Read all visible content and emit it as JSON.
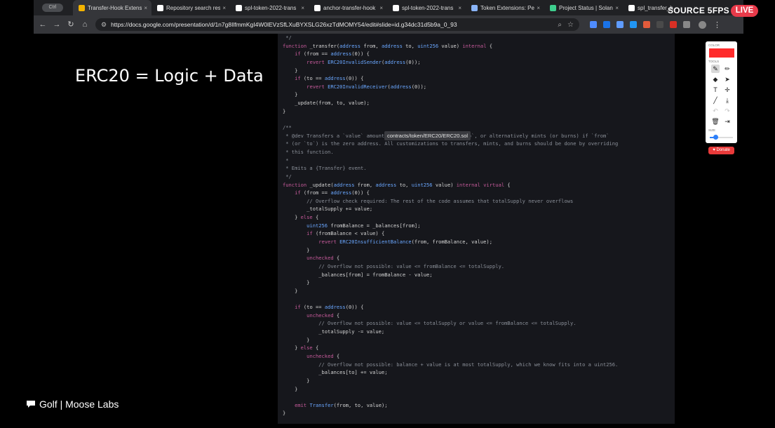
{
  "browser": {
    "tab_pill": "Ctrl",
    "tabs": [
      {
        "label": "Transfer-Hook Extens",
        "favicon_color": "#f4b400",
        "active": true
      },
      {
        "label": "Repository search res",
        "favicon_color": "#ffffff",
        "active": false
      },
      {
        "label": "spl-token-2022-trans",
        "favicon_color": "#ffffff",
        "active": false
      },
      {
        "label": "anchor-transfer-hook",
        "favicon_color": "#ffffff",
        "active": false
      },
      {
        "label": "spl-token-2022-trans",
        "favicon_color": "#ffffff",
        "active": false
      },
      {
        "label": "Token Extensions: Per",
        "favicon_color": "#8ab4f8",
        "active": false
      },
      {
        "label": "Project Status | Solan",
        "favicon_color": "#3ecf8e",
        "active": false
      },
      {
        "label": "spl_transfer_h",
        "favicon_color": "#ffffff",
        "active": false
      }
    ],
    "url": "https://docs.google.com/presentation/d/1n7g8IlfmmKgI4W0lEVzSfLXuBYXSLG26xzTdMOMY54/edit#slide=id.g34dc31d5b9a_0_93",
    "extension_colors": [
      "#4f8cff",
      "#1a73e8",
      "#5f9cff",
      "#2196f3",
      "#e25b3b",
      "#4a4a4a",
      "#d93025",
      "#888888"
    ]
  },
  "stream": {
    "source_badge": "SOURCE 5FPS",
    "live_badge": "LIVE"
  },
  "slide": {
    "title": "ERC20 = Logic + Data"
  },
  "tooltip": "contracts/token/ERC20/ERC20.sol",
  "code_lines": [
    {
      "t": " */",
      "c": "cm"
    },
    {
      "t": "function _transfer(address from, address to, uint256 value) internal {",
      "c": "kw"
    },
    {
      "t": "    if (from == address(0)) {",
      "c": "kw"
    },
    {
      "t": "        revert ERC20InvalidSender(address(0));",
      "c": "err"
    },
    {
      "t": "    }",
      "c": "pl"
    },
    {
      "t": "    if (to == address(0)) {",
      "c": "kw"
    },
    {
      "t": "        revert ERC20InvalidReceiver(address(0));",
      "c": "err"
    },
    {
      "t": "    }",
      "c": "pl"
    },
    {
      "t": "    _update(from, to, value);",
      "c": "pl"
    },
    {
      "t": "}",
      "c": "pl"
    },
    {
      "t": "",
      "c": "pl"
    },
    {
      "t": "/**",
      "c": "cm"
    },
    {
      "t": " * @dev Transfers a `value` amount of tokens from `from` to `to`, or alternatively mints (or burns) if `from`",
      "c": "cm"
    },
    {
      "t": " * (or `to`) is the zero address. All customizations to transfers, mints, and burns should be done by overriding",
      "c": "cm"
    },
    {
      "t": " * this function.",
      "c": "cm"
    },
    {
      "t": " *",
      "c": "cm"
    },
    {
      "t": " * Emits a {Transfer} event.",
      "c": "cm"
    },
    {
      "t": " */",
      "c": "cm"
    },
    {
      "t": "function _update(address from, address to, uint256 value) internal virtual {",
      "c": "kw"
    },
    {
      "t": "    if (from == address(0)) {",
      "c": "kw"
    },
    {
      "t": "        // Overflow check required: The rest of the code assumes that totalSupply never overflows",
      "c": "cm"
    },
    {
      "t": "        _totalSupply += value;",
      "c": "pl"
    },
    {
      "t": "    } else {",
      "c": "kw"
    },
    {
      "t": "        uint256 fromBalance = _balances[from];",
      "c": "kw"
    },
    {
      "t": "        if (fromBalance < value) {",
      "c": "kw"
    },
    {
      "t": "            revert ERC20InsufficientBalance(from, fromBalance, value);",
      "c": "err"
    },
    {
      "t": "        }",
      "c": "pl"
    },
    {
      "t": "        unchecked {",
      "c": "kw"
    },
    {
      "t": "            // Overflow not possible: value <= fromBalance <= totalSupply.",
      "c": "cm"
    },
    {
      "t": "            _balances[from] = fromBalance - value;",
      "c": "pl"
    },
    {
      "t": "        }",
      "c": "pl"
    },
    {
      "t": "    }",
      "c": "pl"
    },
    {
      "t": "",
      "c": "pl"
    },
    {
      "t": "    if (to == address(0)) {",
      "c": "kw"
    },
    {
      "t": "        unchecked {",
      "c": "kw"
    },
    {
      "t": "            // Overflow not possible: value <= totalSupply or value <= fromBalance <= totalSupply.",
      "c": "cm"
    },
    {
      "t": "            _totalSupply -= value;",
      "c": "pl"
    },
    {
      "t": "        }",
      "c": "pl"
    },
    {
      "t": "    } else {",
      "c": "kw"
    },
    {
      "t": "        unchecked {",
      "c": "kw"
    },
    {
      "t": "            // Overflow not possible: balance + value is at most totalSupply, which we know fits into a uint256.",
      "c": "cm"
    },
    {
      "t": "            _balances[to] += value;",
      "c": "pl"
    },
    {
      "t": "        }",
      "c": "pl"
    },
    {
      "t": "    }",
      "c": "pl"
    },
    {
      "t": "",
      "c": "pl"
    },
    {
      "t": "    emit Transfer(from, to, value);",
      "c": "kw"
    },
    {
      "t": "}",
      "c": "pl"
    }
  ],
  "syntax_colors": {
    "keyword": "#c55a9a",
    "type": "#6aa7ff",
    "error": "#6aa7ff",
    "comment": "#8a8f98",
    "plain": "#d4d4d4",
    "function": "#f0c674"
  },
  "palette": {
    "color_label": "COLOR",
    "tools_label": "TOOLS",
    "size_label": "SIZE",
    "selected_color": "#ff2b2b",
    "size_value": 0.25,
    "donate_label": "Donate"
  },
  "footer": {
    "text": "Golf | Moose Labs"
  }
}
